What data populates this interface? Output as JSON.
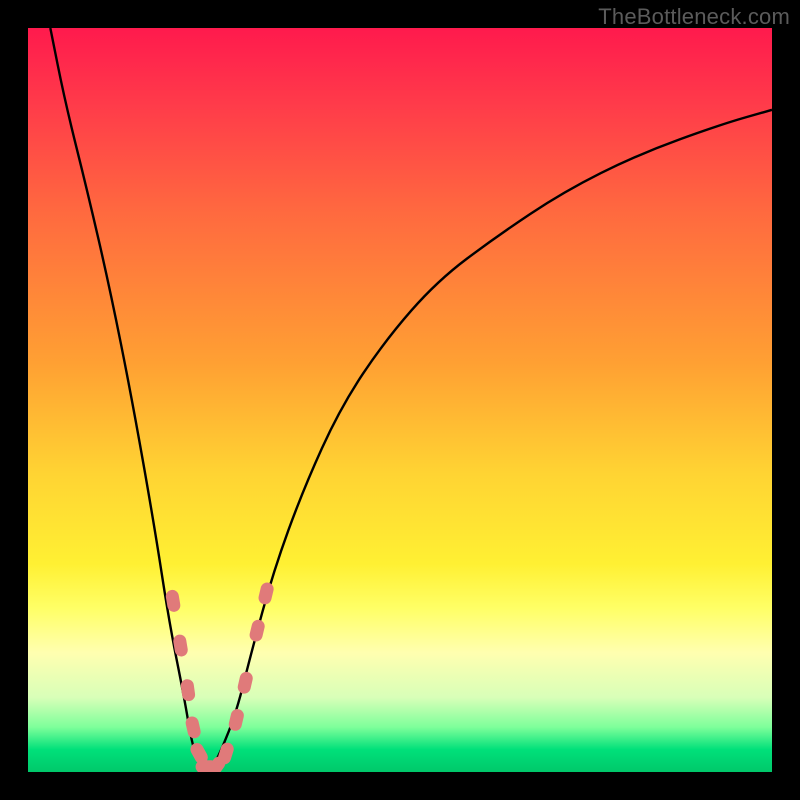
{
  "watermark": "TheBottleneck.com",
  "chart_data": {
    "type": "line",
    "title": "",
    "xlabel": "",
    "ylabel": "",
    "xlim": [
      0,
      100
    ],
    "ylim": [
      0,
      100
    ],
    "grid": false,
    "series": [
      {
        "name": "bottleneck-curve",
        "color": "#000000",
        "x": [
          3,
          5,
          8,
          11,
          14,
          17,
          19,
          21,
          22,
          23,
          24,
          25,
          26,
          28,
          30,
          33,
          37,
          42,
          48,
          55,
          63,
          72,
          82,
          93,
          100
        ],
        "y": [
          100,
          90,
          78,
          65,
          50,
          33,
          20,
          10,
          4,
          1,
          0,
          1,
          3,
          8,
          16,
          27,
          38,
          49,
          58,
          66,
          72,
          78,
          83,
          87,
          89
        ]
      }
    ],
    "markers": [
      {
        "name": "highlight-dots",
        "color": "#e07a7a",
        "shape": "capsule",
        "points": [
          {
            "x": 19.5,
            "y": 23
          },
          {
            "x": 20.5,
            "y": 17
          },
          {
            "x": 21.5,
            "y": 11
          },
          {
            "x": 22.2,
            "y": 6
          },
          {
            "x": 23.0,
            "y": 2.5
          },
          {
            "x": 24.0,
            "y": 0.7
          },
          {
            "x": 25.3,
            "y": 0.7
          },
          {
            "x": 26.6,
            "y": 2.5
          },
          {
            "x": 28.0,
            "y": 7
          },
          {
            "x": 29.2,
            "y": 12
          },
          {
            "x": 30.8,
            "y": 19
          },
          {
            "x": 32.0,
            "y": 24
          }
        ]
      }
    ]
  }
}
